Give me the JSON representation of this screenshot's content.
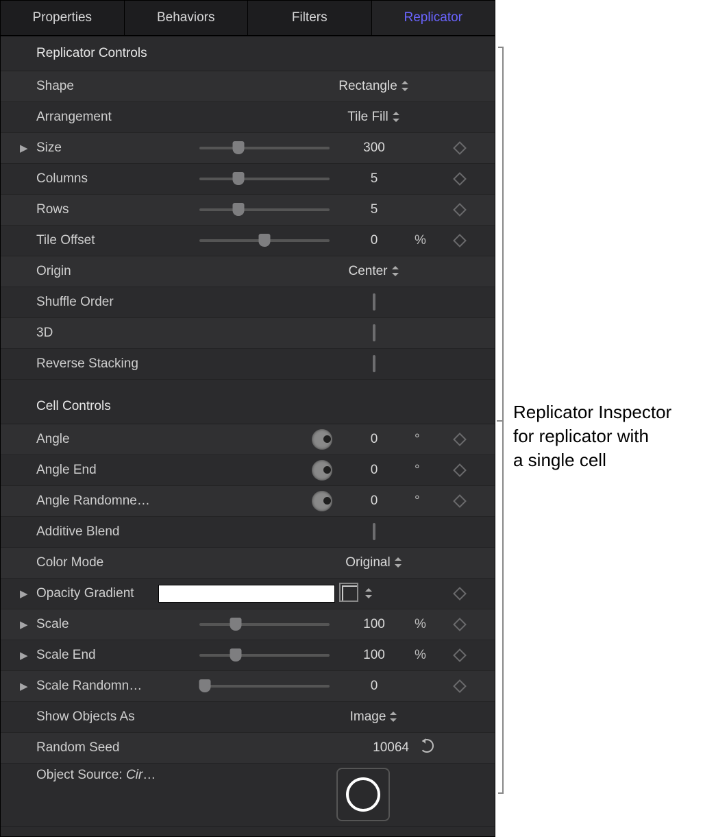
{
  "tabs": {
    "properties": "Properties",
    "behaviors": "Behaviors",
    "filters": "Filters",
    "replicator": "Replicator"
  },
  "section1": {
    "title": "Replicator Controls",
    "shape": {
      "label": "Shape",
      "value": "Rectangle"
    },
    "arrangement": {
      "label": "Arrangement",
      "value": "Tile Fill"
    },
    "size": {
      "label": "Size",
      "value": "300",
      "pos": 30
    },
    "columns": {
      "label": "Columns",
      "value": "5",
      "pos": 30
    },
    "rows": {
      "label": "Rows",
      "value": "5",
      "pos": 30
    },
    "tileOffset": {
      "label": "Tile Offset",
      "value": "0",
      "unit": "%",
      "pos": 50
    },
    "origin": {
      "label": "Origin",
      "value": "Center"
    },
    "shuffle": {
      "label": "Shuffle Order"
    },
    "threeD": {
      "label": "3D"
    },
    "reverse": {
      "label": "Reverse Stacking"
    }
  },
  "section2": {
    "title": "Cell Controls",
    "angle": {
      "label": "Angle",
      "value": "0",
      "unit": "°"
    },
    "angleEnd": {
      "label": "Angle End",
      "value": "0",
      "unit": "°"
    },
    "angleRand": {
      "label": "Angle Randomne…",
      "value": "0",
      "unit": "°"
    },
    "additive": {
      "label": "Additive Blend"
    },
    "colorMode": {
      "label": "Color Mode",
      "value": "Original"
    },
    "opacityGrad": {
      "label": "Opacity Gradient"
    },
    "scale": {
      "label": "Scale",
      "value": "100",
      "unit": "%",
      "pos": 28
    },
    "scaleEnd": {
      "label": "Scale End",
      "value": "100",
      "unit": "%",
      "pos": 28
    },
    "scaleRand": {
      "label": "Scale Randomn…",
      "value": "0",
      "pos": 4
    },
    "showAs": {
      "label": "Show Objects As",
      "value": "Image"
    },
    "seed": {
      "label": "Random Seed",
      "value": "10064"
    },
    "source": {
      "label_prefix": "Object Source: ",
      "label_name": "Circle"
    }
  },
  "annotation": {
    "line1": "Replicator Inspector",
    "line2": "for replicator with",
    "line3": "a single cell"
  }
}
